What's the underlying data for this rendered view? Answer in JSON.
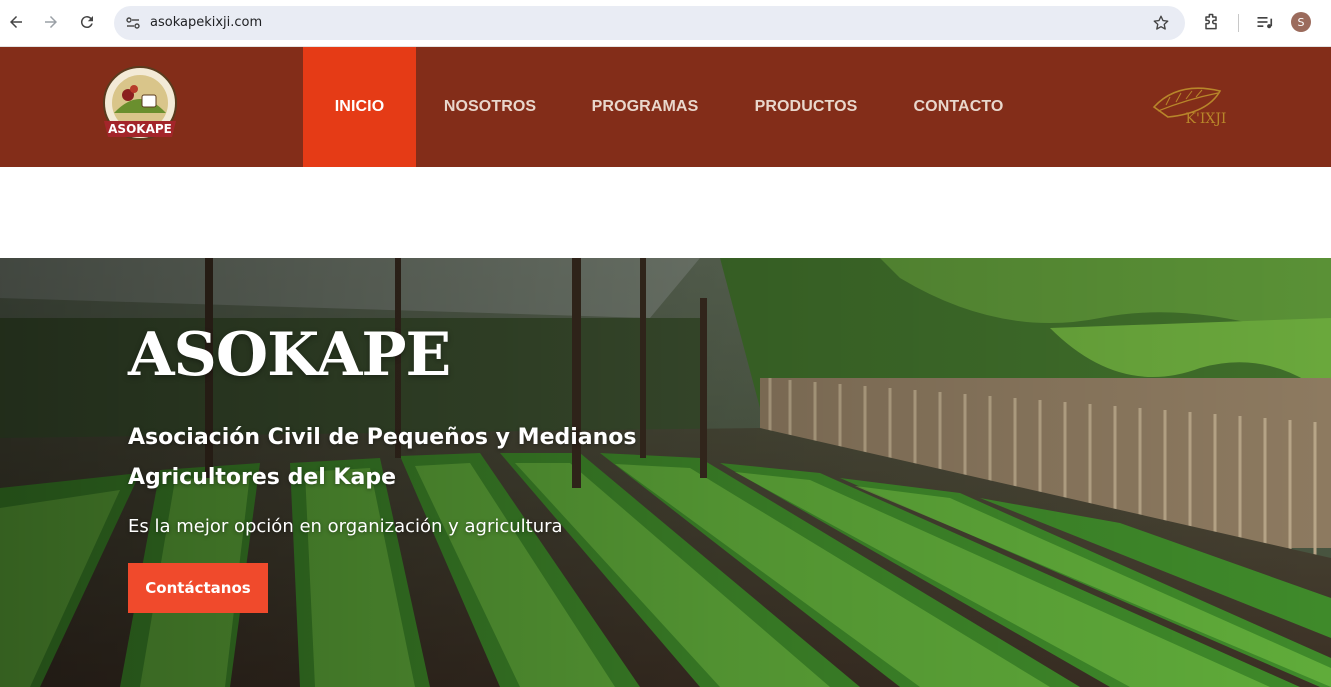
{
  "browser": {
    "url": "asokapekixji.com",
    "profile_initial": "S",
    "icons": [
      "back-icon",
      "forward-icon",
      "reload-icon",
      "site-info-icon",
      "star-icon",
      "extensions-icon",
      "media-icon",
      "profile-avatar"
    ]
  },
  "header": {
    "logo_text": "ASOKAPE",
    "brand_mark_text": "K'IXJI",
    "nav": [
      {
        "label": "INICIO",
        "active": true
      },
      {
        "label": "NOSOTROS",
        "active": false
      },
      {
        "label": "PROGRAMAS",
        "active": false
      },
      {
        "label": "PRODUCTOS",
        "active": false
      },
      {
        "label": "CONTACTO",
        "active": false
      }
    ]
  },
  "hero": {
    "title": "ASOKAPE",
    "subtitle": "Asociación Civil de Pequeños y Medianos Agricultores del Kape",
    "text": "Es la mejor opción en organización y agricultura",
    "cta_label": "Contáctanos"
  },
  "colors": {
    "header_bg": "#832d19",
    "nav_active_bg": "#e53b16",
    "cta_bg": "#f04a2c"
  }
}
